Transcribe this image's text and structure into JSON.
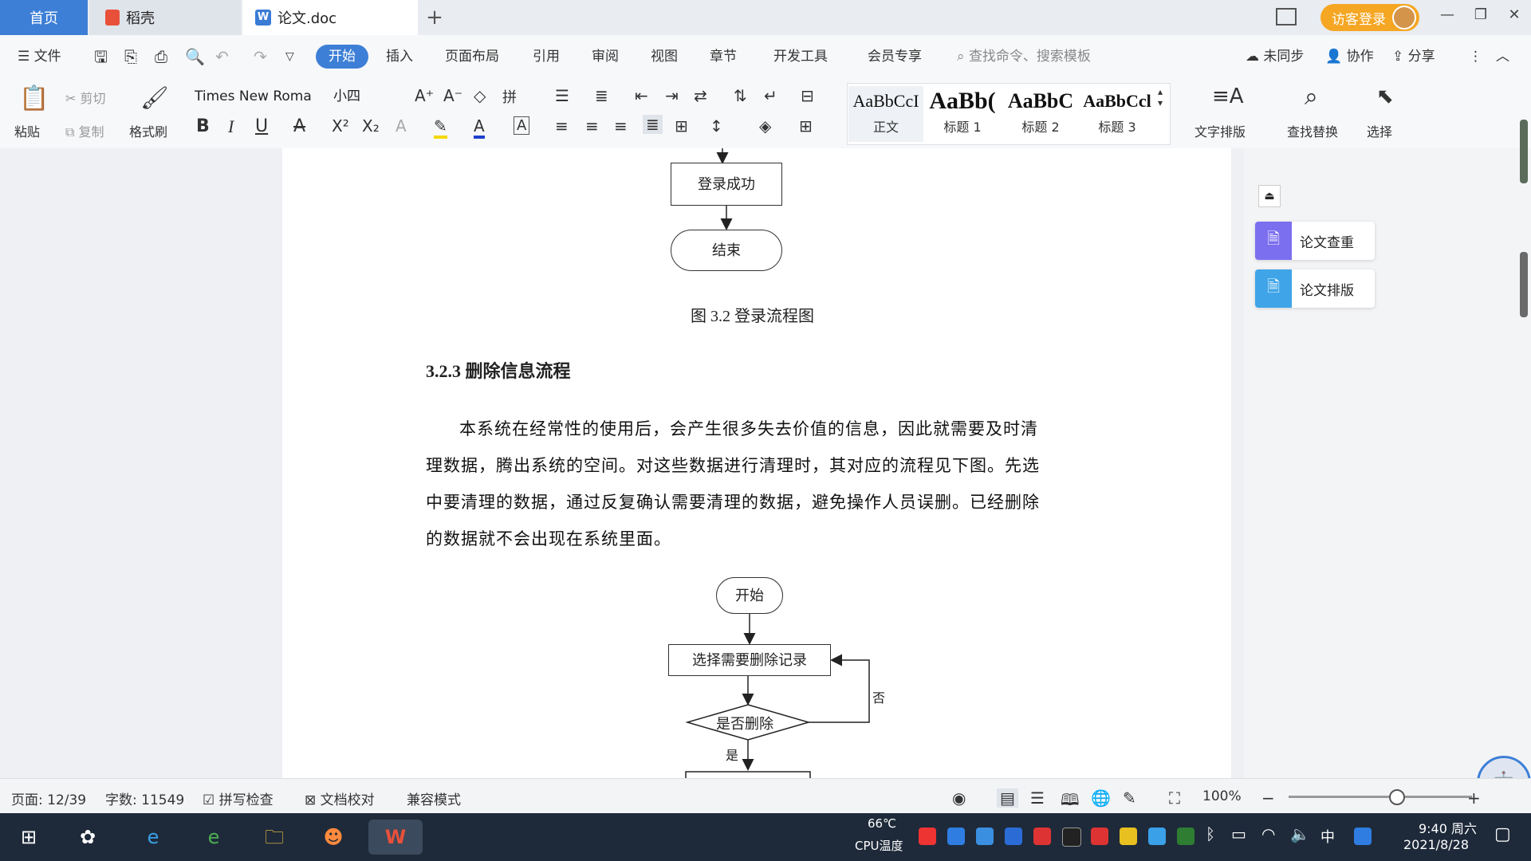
{
  "tabs": {
    "home": "首页",
    "daoke": "稻壳",
    "doc": "论文.doc",
    "add": "+"
  },
  "header": {
    "visitor_login": "访客登录"
  },
  "menu": {
    "file": "文件",
    "items": [
      "开始",
      "插入",
      "页面布局",
      "引用",
      "审阅",
      "视图",
      "章节",
      "开发工具",
      "会员专享"
    ],
    "search_placeholder": "查找命令、搜索模板",
    "sync": "未同步",
    "collab": "协作",
    "share": "分享"
  },
  "ribbon": {
    "paste": "粘贴",
    "cut": "剪切",
    "copy": "复制",
    "format_painter": "格式刷",
    "font_name": "Times New Roma",
    "font_size": "小四",
    "styles": [
      {
        "preview": "AaBbCcI",
        "label": "正文"
      },
      {
        "preview": "AaBb(",
        "label": "标题 1"
      },
      {
        "preview": "AaBbC",
        "label": "标题 2"
      },
      {
        "preview": "AaBbCcl",
        "label": "标题 3"
      }
    ],
    "text_layout": "文字排版",
    "find_replace": "查找替换",
    "select": "选择"
  },
  "document": {
    "login_success": "登录成功",
    "end": "结束",
    "figure_caption": "图 3.2  登录流程图",
    "section_heading": "3.2.3  删除信息流程",
    "paragraph_lines": [
      "本系统在经常性的使用后，会产生很多失去价值的信息，因此就需要及时清",
      "理数据，腾出系统的空间。对这些数据进行清理时，其对应的流程见下图。先选",
      "中要清理的数据，通过反复确认需要清理的数据，避免操作人员误删。已经删除",
      "的数据就不会出现在系统里面。"
    ],
    "flow_start": "开始",
    "flow_select": "选择需要删除记录",
    "flow_decision": "是否删除",
    "flow_no": "否",
    "flow_yes": "是"
  },
  "side_panel": {
    "check": "论文查重",
    "layout": "论文排版"
  },
  "status": {
    "page": "页面: 12/39",
    "words": "字数: 11549",
    "spell": "拼写检查",
    "proof": "文档校对",
    "compat": "兼容模式",
    "zoom": "100%",
    "zoom_level_percent": 100
  },
  "taskbar": {
    "temp": "66℃",
    "temp_label": "CPU温度",
    "ime": "中",
    "time": "9:40 周六",
    "date": "2021/8/28"
  },
  "colors": {
    "accent": "#3d7fd6",
    "visitor": "#f5a623",
    "taskbar": "#1e2a3a"
  }
}
